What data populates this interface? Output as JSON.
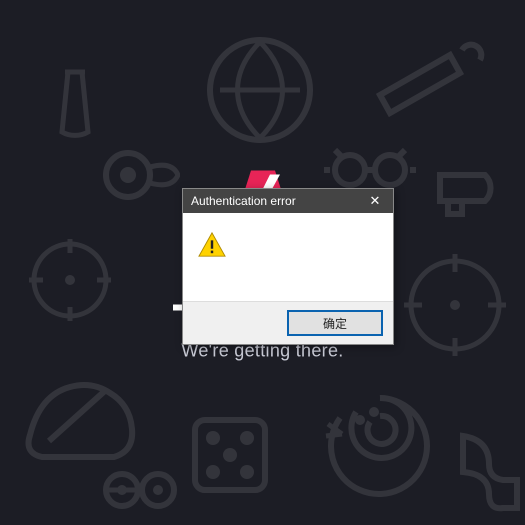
{
  "background": {
    "color": "#1c1d25",
    "icon_color": "#393b48"
  },
  "loader": {
    "brand_color": "#e72457",
    "progress_percent": 22,
    "status_text": "We're getting there."
  },
  "dialog": {
    "title": "Authentication error",
    "icon": "warning-triangle",
    "message": "",
    "ok_label": "确定",
    "close_label": "✕"
  }
}
